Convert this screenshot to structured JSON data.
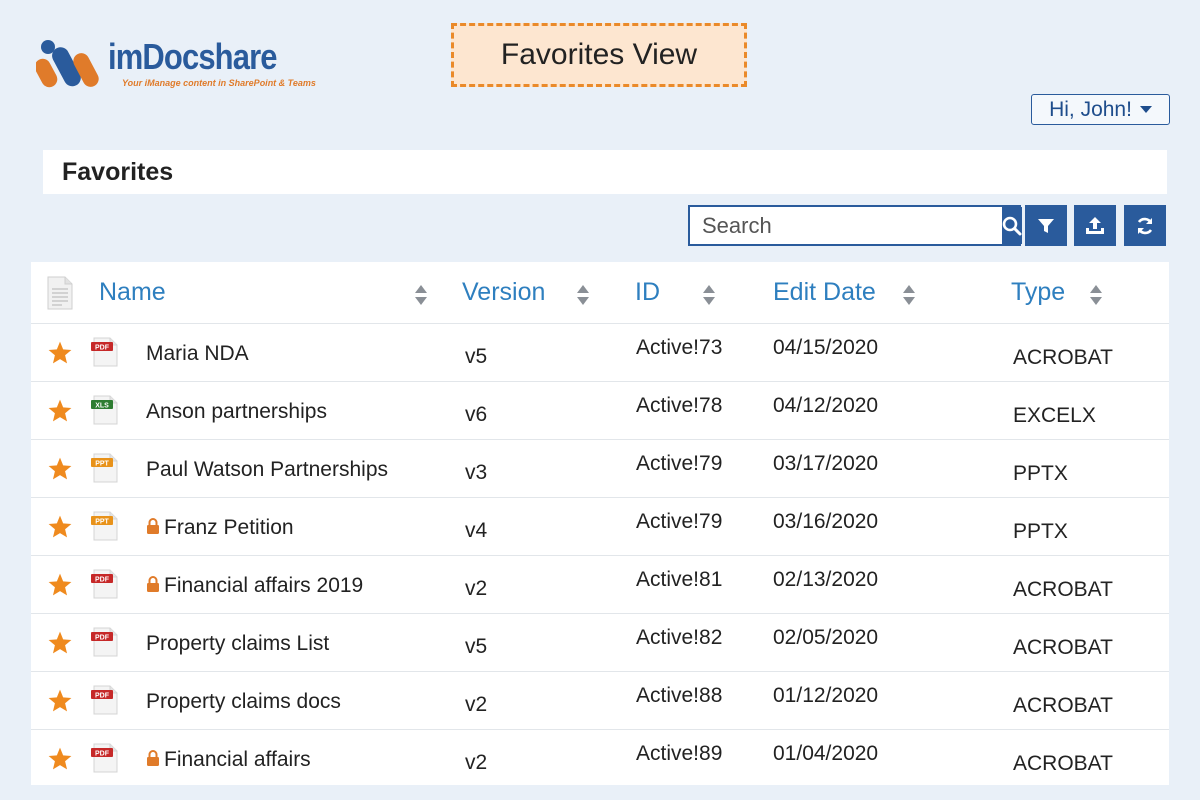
{
  "brand": {
    "name": "imDocshare",
    "tagline": "Your iManage content in SharePoint & Teams",
    "colors": {
      "blue": "#2a5b9c",
      "orange": "#e07b2a"
    }
  },
  "view_label": "Favorites View",
  "user": {
    "greeting": "Hi, John!",
    "menu_icon": "caret-down-icon"
  },
  "section_title": "Favorites",
  "toolbar": {
    "search_placeholder": "Search",
    "buttons": [
      "search-icon",
      "filter-icon",
      "upload-icon",
      "refresh-icon"
    ]
  },
  "table": {
    "columns": [
      "Name",
      "Version",
      "ID",
      "Edit Date",
      "Type"
    ],
    "rows": [
      {
        "name": "Maria NDA",
        "version": "v5",
        "id": "Active!73",
        "date": "04/15/2020",
        "type": "ACROBAT",
        "icon": "pdf-file-icon",
        "icon_label": "PDF",
        "icon_color": "#c62828",
        "locked": false
      },
      {
        "name": "Anson partnerships",
        "version": "v6",
        "id": "Active!78",
        "date": "04/12/2020",
        "type": "EXCELX",
        "icon": "xls-file-icon",
        "icon_label": "XLS",
        "icon_color": "#2e7d32",
        "locked": false
      },
      {
        "name": "Paul Watson Partnerships",
        "version": "v3",
        "id": "Active!79",
        "date": "03/17/2020",
        "type": "PPTX",
        "icon": "ppt-file-icon",
        "icon_label": "PPT",
        "icon_color": "#e8921a",
        "locked": false
      },
      {
        "name": "Franz Petition",
        "version": "v4",
        "id": "Active!79",
        "date": "03/16/2020",
        "type": "PPTX",
        "icon": "ppt-file-icon",
        "icon_label": "PPT",
        "icon_color": "#e8921a",
        "locked": true
      },
      {
        "name": "Financial affairs  2019",
        "version": "v2",
        "id": "Active!81",
        "date": "02/13/2020",
        "type": "ACROBAT",
        "icon": "pdf-file-icon",
        "icon_label": "PDF",
        "icon_color": "#c62828",
        "locked": true
      },
      {
        "name": "Property claims List",
        "version": "v5",
        "id": "Active!82",
        "date": "02/05/2020",
        "type": "ACROBAT",
        "icon": "pdf-file-icon",
        "icon_label": "PDF",
        "icon_color": "#c62828",
        "locked": false
      },
      {
        "name": "Property claims docs",
        "version": "v2",
        "id": "Active!88",
        "date": "01/12/2020",
        "type": "ACROBAT",
        "icon": "pdf-file-icon",
        "icon_label": "PDF",
        "icon_color": "#c62828",
        "locked": false
      },
      {
        "name": "Financial affairs",
        "version": "v2",
        "id": "Active!89",
        "date": "01/04/2020",
        "type": "ACROBAT",
        "icon": "pdf-file-icon",
        "icon_label": "PDF",
        "icon_color": "#c62828",
        "locked": true
      }
    ]
  },
  "accent_colors": {
    "star": "#ef8a1e",
    "lock": "#e07b2a",
    "column_header": "#2e7fbf"
  }
}
